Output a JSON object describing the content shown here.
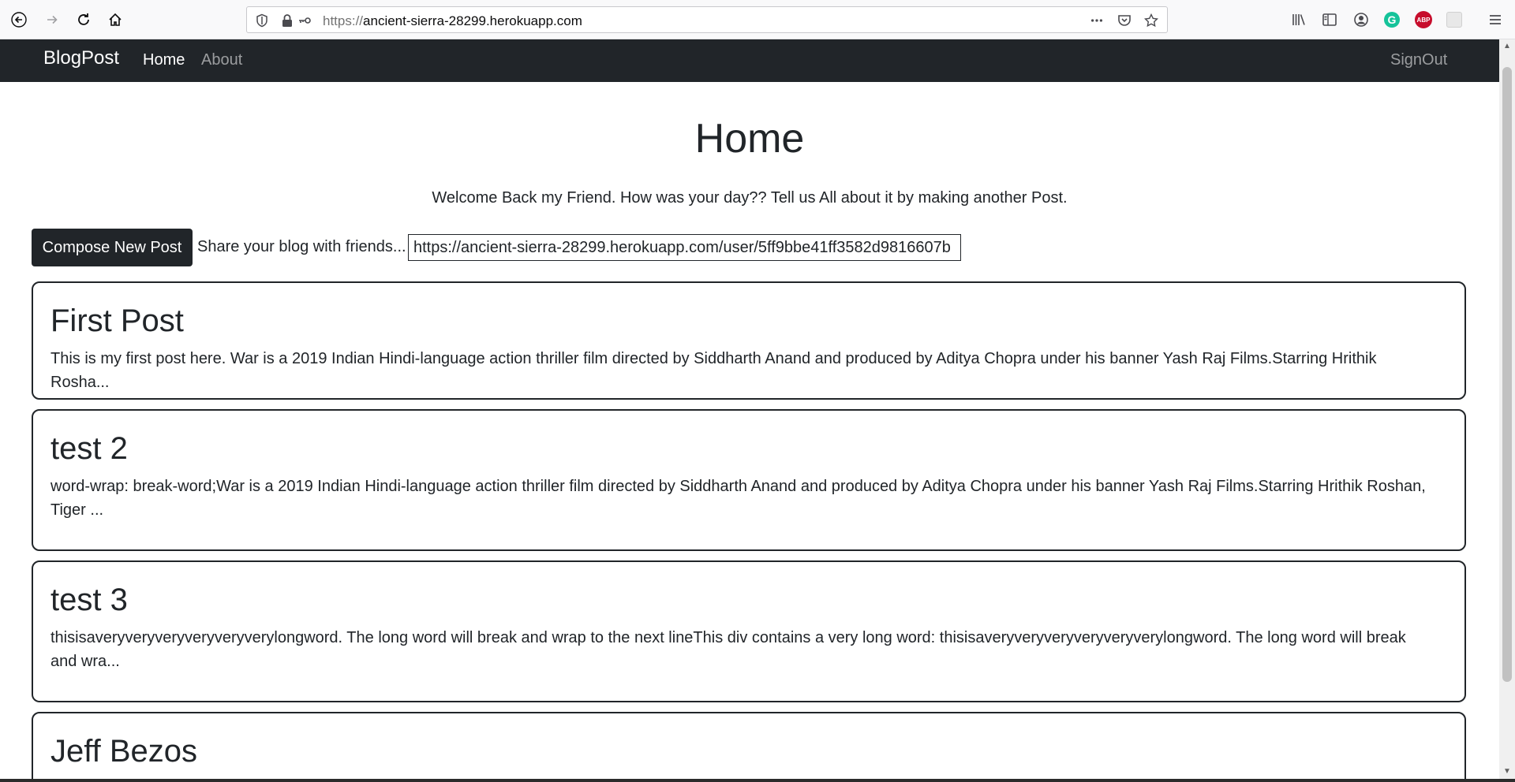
{
  "browser": {
    "url_host": "ancient-sierra-28299.herokuapp.com",
    "url_prefix": "https://",
    "icons": {
      "back": "back-arrow-icon",
      "forward": "forward-arrow-icon",
      "reload": "reload-icon",
      "home": "home-icon",
      "shield": "tracking-shield-icon",
      "lock": "lock-icon",
      "key": "key-icon",
      "more": "more-icon",
      "pocket": "pocket-icon",
      "bookmark": "star-icon",
      "library": "library-icon",
      "sidebar": "sidebar-icon",
      "account": "account-icon",
      "grammarly": "grammarly-icon",
      "adblock": "adblock-icon",
      "extension": "extension-icon",
      "menu": "hamburger-menu-icon"
    },
    "grammarly_letter": "G",
    "adblock_text": "ABP"
  },
  "navbar": {
    "brand": "BlogPost",
    "links": [
      {
        "label": "Home",
        "active": true
      },
      {
        "label": "About",
        "active": false
      }
    ],
    "signout": "SignOut"
  },
  "main": {
    "title": "Home",
    "welcome": "Welcome Back my Friend. How was your day?? Tell us All about it by making another Post.",
    "compose_label": "Compose New Post",
    "share_label": "Share your blog with friends...",
    "share_link": "https://ancient-sierra-28299.herokuapp.com/user/5ff9bbe41ff3582d9816607b"
  },
  "posts": [
    {
      "title": "First Post",
      "body": "This is my first post here. War is a 2019 Indian Hindi-language action thriller film directed by Siddharth Anand and produced by Aditya Chopra under his banner Yash Raj Films.Starring Hrithik Rosha..."
    },
    {
      "title": "test 2",
      "body": "word-wrap: break-word;War is a 2019 Indian Hindi-language action thriller film directed by Siddharth Anand and produced by Aditya Chopra under his banner Yash Raj Films.Starring Hrithik Roshan, Tiger ..."
    },
    {
      "title": "test 3",
      "body": "thisisaveryveryveryveryveryverylongword. The long word will break and wrap to the next lineThis div contains a very long word: thisisaveryveryveryveryveryverylongword. The long word will break and wra..."
    },
    {
      "title": "Jeff Bezos",
      "body": ""
    }
  ],
  "colors": {
    "navbar_bg": "#212529",
    "text": "#212529",
    "muted_nav": "rgba(255,255,255,0.55)"
  }
}
